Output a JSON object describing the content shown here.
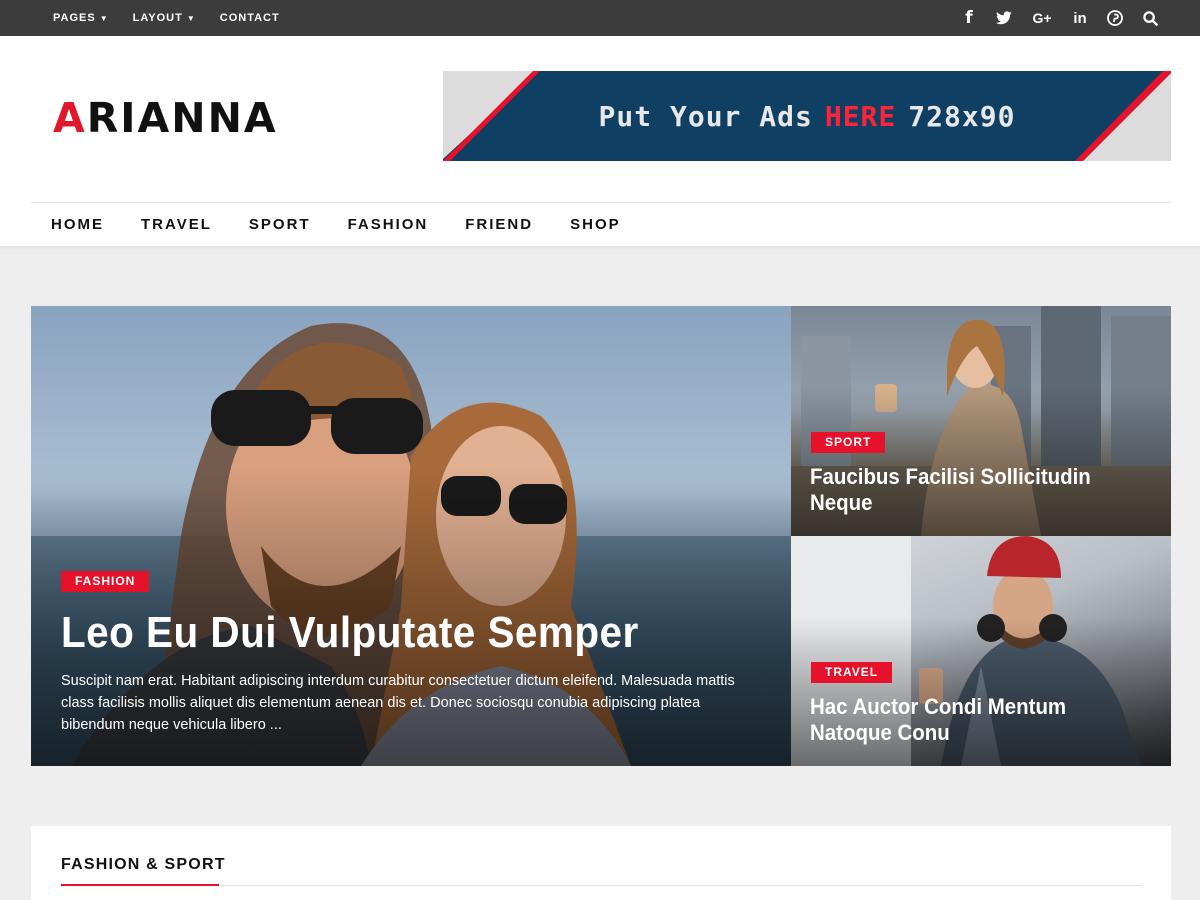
{
  "topbar": {
    "nav": [
      {
        "label": "PAGES",
        "has_dropdown": true
      },
      {
        "label": "LAYOUT",
        "has_dropdown": true
      },
      {
        "label": "CONTACT",
        "has_dropdown": false
      }
    ],
    "social_icons": [
      "facebook-icon",
      "twitter-icon",
      "google-plus-icon",
      "linkedin-icon",
      "pinterest-icon",
      "search-icon"
    ],
    "glyphs": {
      "facebook": "f",
      "twitter": "🐦",
      "gplus": "G+",
      "linkedin": "in",
      "pinterest": "ⓟ",
      "search": "⌕",
      "chevron": "▼"
    }
  },
  "header": {
    "logo_first": "A",
    "logo_rest": "RIANNA",
    "ad": {
      "prefix": "Put Your Ads",
      "highlight": "HERE",
      "size": "728x90"
    }
  },
  "main_nav": [
    "HOME",
    "TRAVEL",
    "SPORT",
    "FASHION",
    "FRIEND",
    "SHOP"
  ],
  "featured": {
    "tag": "FASHION",
    "title": "Leo Eu Dui Vulputate Semper",
    "excerpt": "Suscipit nam erat. Habitant adipiscing interdum curabitur consectetuer dictum eleifend. Malesuada mattis class facilisis mollis aliquet dis elementum aenean dis et. Donec sociosqu conubia adipiscing platea bibendum neque vehicula libero ..."
  },
  "side_posts": [
    {
      "tag": "SPORT",
      "title": "Faucibus Facilisi Sollicitudin Neque"
    },
    {
      "tag": "TRAVEL",
      "title": "Hac Auctor Condi Mentum Natoque Conu"
    }
  ],
  "section": {
    "title": "FASHION & SPORT"
  },
  "colors": {
    "accent": "#e6112b",
    "topbar": "#3c3c3c",
    "ad_navy": "#0f3f63",
    "background": "#eeeeee"
  }
}
